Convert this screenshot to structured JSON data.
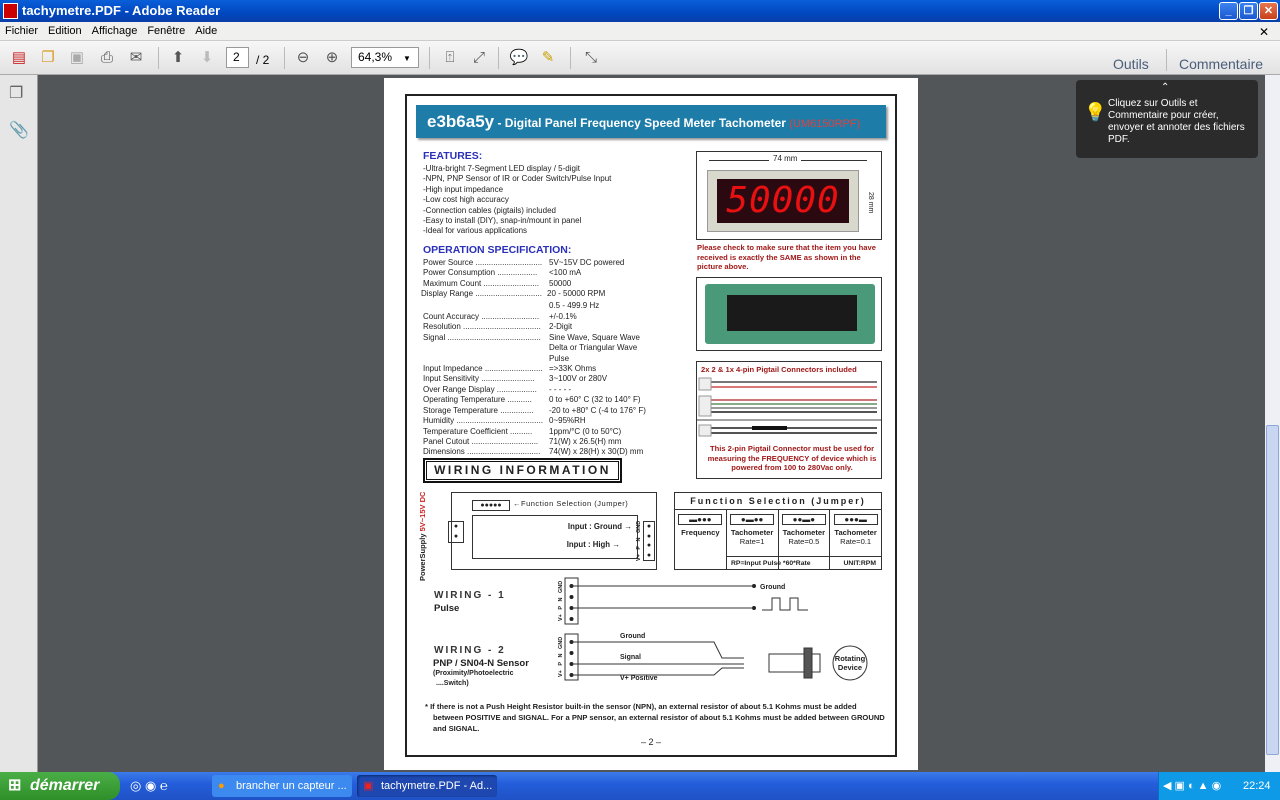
{
  "window": {
    "title": "tachymetre.PDF - Adobe Reader",
    "controls": [
      "_",
      "❐",
      "✕"
    ]
  },
  "menu": [
    "Fichier",
    "Edition",
    "Affichage",
    "Fenêtre",
    "Aide"
  ],
  "toolbar": {
    "page_current": "2",
    "page_total": "/ 2",
    "zoom": "64,3%",
    "tools_label": "Outils",
    "comment_label": "Commentaire"
  },
  "tooltip": {
    "text": "Cliquez sur Outils et Commentaire pour créer, envoyer et annoter des fichiers PDF."
  },
  "doc": {
    "header": {
      "brand": "e3b6a5y",
      "title": " - Digital Panel Frequency Speed Meter Tachometer ",
      "model": "(UM6150RPF)"
    },
    "features_title": "FEATURES:",
    "features": [
      "-Ultra-bright 7-Segment LED display / 5-digit",
      "-NPN, PNP Sensor of IR or Coder Switch/Pulse Input",
      "-High input impedance",
      "-Low cost high accuracy",
      "-Connection cables (pigtails) included",
      "-Easy to install (DIY), snap-in/mount in panel",
      "-Ideal for various applications"
    ],
    "spec_title": "OPERATION SPECIFICATION:",
    "specs": [
      {
        "k": "Power Source ..............................",
        "v": "5V~15V DC powered"
      },
      {
        "k": "Power Consumption ..................",
        "v": "<100 mA"
      },
      {
        "k": "Maximum Count .........................",
        "v": "50000"
      },
      {
        "k": "Display Range ..............................",
        "v": "20 - 50000 RPM"
      },
      {
        "k": "",
        "v": "0.5 - 499.9 Hz"
      },
      {
        "k": "Count Accuracy ..........................",
        "v": "+/-0.1%"
      },
      {
        "k": "Resolution ...................................",
        "v": "2-Digit"
      },
      {
        "k": "Signal ..........................................",
        "v": "Sine Wave, Square Wave"
      },
      {
        "k": "",
        "v": "Delta or Triangular Wave"
      },
      {
        "k": "",
        "v": "Pulse"
      },
      {
        "k": "Input Impedance ..........................",
        "v": "=>33K Ohms"
      },
      {
        "k": "Input Sensitivity ........................",
        "v": "3~100V or 280V"
      },
      {
        "k": "Over Range Display ..................",
        "v": "- - - - -"
      },
      {
        "k": "Operating Temperature ...........",
        "v": "0 to +60° C (32 to 140° F)"
      },
      {
        "k": "Storage Temperature ...............",
        "v": "-20 to +80° C (-4 to 176° F)"
      },
      {
        "k": "Humidity .......................................",
        "v": "0~95%RH"
      },
      {
        "k": "Temperature Coefficient ..........",
        "v": "1ppm/°C (0 to 50°C)"
      },
      {
        "k": "Panel Cutout ..............................",
        "v": "71(W) x 26.5(H) mm"
      },
      {
        "k": "Dimensions .................................",
        "v": "74(W) x 28(H) x 30(D) mm"
      }
    ],
    "display": {
      "width_label": "74 mm",
      "height_label": "28 mm",
      "readout": "50000"
    },
    "check_note": "Please check to make sure that the item you have received is exactly the SAME as shown in the picture above.",
    "pigtail_title": "2x 2 & 1x 4-pin Pigtail Connectors included",
    "pigtail_note": "This 2-pin Pigtail Connector must be used for measuring  the FREQUENCY  of device which is powered from 100 to 280Vac only.",
    "wiring_title": "WIRING   INFORMATION",
    "power_supply": "PowerSupply",
    "power_voltage": "5V~15V DC",
    "jumper_label": "←Function Selection (Jumper)",
    "input_ground": "Input : Ground →",
    "input_high": "Input : High →",
    "pins": "V+ P N GND",
    "fs": {
      "title": "Function Selection (Jumper)",
      "cols": [
        {
          "l1": "Frequency",
          "l2": ""
        },
        {
          "l1": "Tachometer",
          "l2": "Rate=1"
        },
        {
          "l1": "Tachometer",
          "l2": "Rate=0.5"
        },
        {
          "l1": "Tachometer",
          "l2": "Rate=0.1"
        }
      ],
      "formula": "RP=Input Pulse *60*Rate",
      "unit": "UNIT:RPM"
    },
    "w1": {
      "title": "WIRING  -  1",
      "sub": "Pulse",
      "ground": "Ground"
    },
    "w2": {
      "title": "WIRING  -  2",
      "sub": "PNP / SN04-N Sensor",
      "sub2": "(Proximity/Photoelectric",
      "sub3": "....Switch)",
      "ground": "Ground",
      "signal": "Signal",
      "vplus": "V+ Positive",
      "device": "Rotating Device"
    },
    "footnote": "* If there is not a Push Height Resistor built-in the sensor (NPN), an external resistor of about 5.1 Kohms must be added between POSITIVE and SIGNAL.   For a PNP sensor,  an external resistor of about 5.1 Kohms must be added between GROUND and SIGNAL.",
    "page_number": "– 2 –"
  },
  "taskbar": {
    "start": "démarrer",
    "tasks": [
      "brancher un capteur ...",
      "tachymetre.PDF - Ad..."
    ],
    "clock": "22:24"
  },
  "colors": {
    "banner": "#1d7ca8",
    "heading": "#2a30b8",
    "warning": "#a01818",
    "led": "#e81010"
  }
}
